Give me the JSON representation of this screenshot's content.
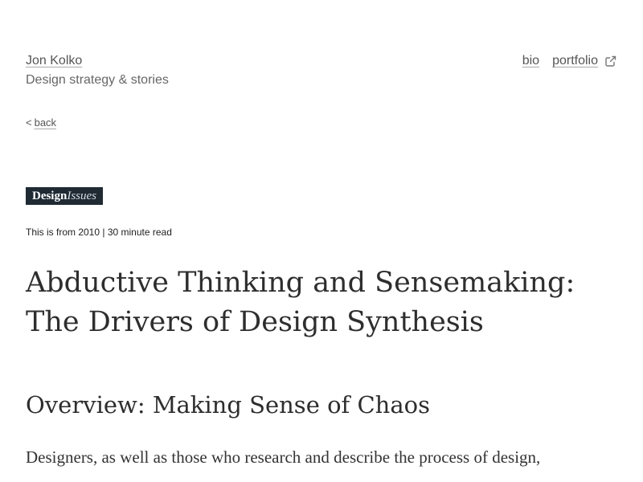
{
  "header": {
    "site_name": "Jon Kolko",
    "tagline": "Design strategy & stories",
    "nav": {
      "bio_label": "bio",
      "portfolio_label": "portfolio"
    }
  },
  "back": {
    "prefix": "<",
    "label": "back"
  },
  "article": {
    "journal_logo": {
      "part1": "Design",
      "part2": "Issues"
    },
    "meta": "This is from 2010 | 30 minute read",
    "title": "Abductive Thinking and Sensemaking: The Drivers of Design Synthesis",
    "section_heading": "Overview: Making Sense of Chaos",
    "body_first_line": "Designers, as well as those who research and describe the process of design,"
  },
  "icons": {
    "external_link": "external-link-icon"
  },
  "colors": {
    "text": "#333333",
    "muted": "#666666",
    "logo_background": "#1f2a33"
  }
}
